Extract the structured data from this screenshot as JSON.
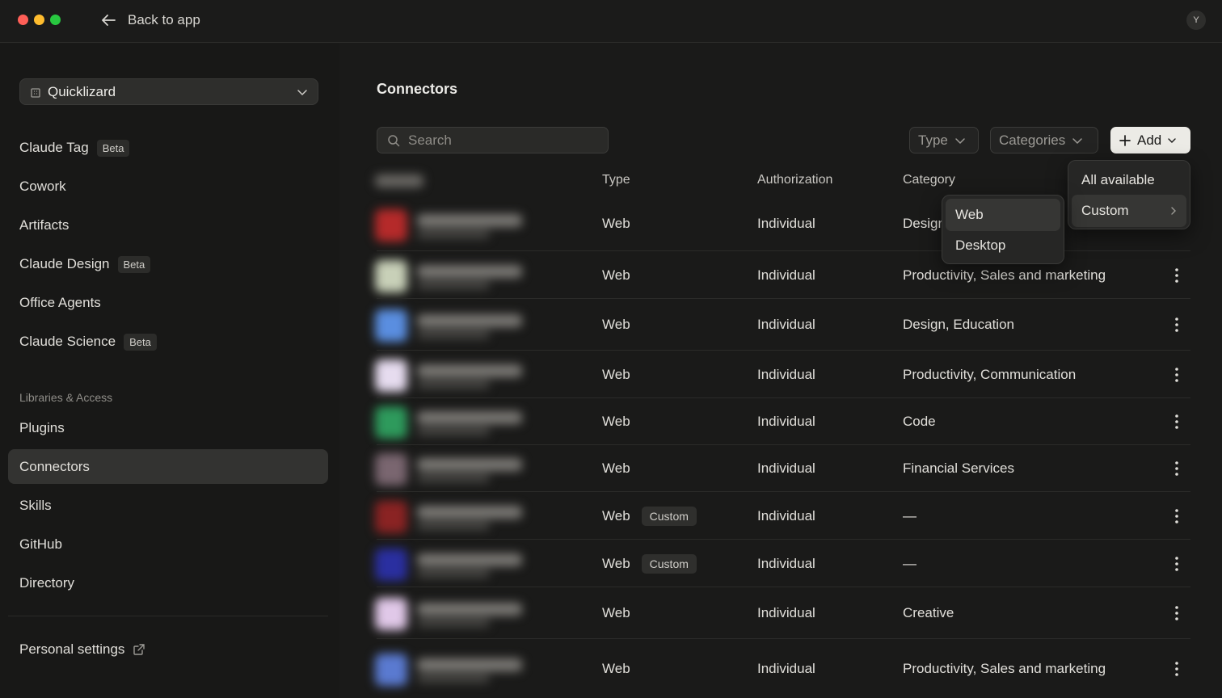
{
  "titlebar": {
    "back_label": "Back to app",
    "avatar_initial": "Y"
  },
  "sidebar": {
    "org_name": "Quicklizard",
    "items": [
      {
        "label": "Claude Tag",
        "badge": "Beta"
      },
      {
        "label": "Cowork",
        "badge": ""
      },
      {
        "label": "Artifacts",
        "badge": ""
      },
      {
        "label": "Claude Design",
        "badge": "Beta"
      },
      {
        "label": "Office Agents",
        "badge": ""
      },
      {
        "label": "Claude Science",
        "badge": "Beta"
      }
    ],
    "section_label": "Libraries & Access",
    "library_items": [
      {
        "label": "Plugins"
      },
      {
        "label": "Connectors",
        "active": true
      },
      {
        "label": "Skills"
      },
      {
        "label": "GitHub"
      },
      {
        "label": "Directory"
      }
    ],
    "personal_settings": "Personal settings"
  },
  "main": {
    "title": "Connectors",
    "search_placeholder": "Search",
    "filters": {
      "type": "Type",
      "categories": "Categories"
    },
    "add_label": "Add",
    "columns": {
      "type": "Type",
      "authorization": "Authorization",
      "category": "Category"
    },
    "rows": [
      {
        "type": "Web",
        "custom": "",
        "auth": "Individual",
        "category": "Design"
      },
      {
        "type": "Web",
        "custom": "",
        "auth": "Individual",
        "category": "Productivity, Sales and marketing"
      },
      {
        "type": "Web",
        "custom": "",
        "auth": "Individual",
        "category": "Design, Education"
      },
      {
        "type": "Web",
        "custom": "",
        "auth": "Individual",
        "category": "Productivity, Communication"
      },
      {
        "type": "Web",
        "custom": "",
        "auth": "Individual",
        "category": "Code"
      },
      {
        "type": "Web",
        "custom": "",
        "auth": "Individual",
        "category": "Financial Services"
      },
      {
        "type": "Web",
        "custom": "Custom",
        "auth": "Individual",
        "category": "—"
      },
      {
        "type": "Web",
        "custom": "Custom",
        "auth": "Individual",
        "category": "—"
      },
      {
        "type": "Web",
        "custom": "",
        "auth": "Individual",
        "category": "Creative"
      },
      {
        "type": "Web",
        "custom": "",
        "auth": "Individual",
        "category": "Productivity, Sales and marketing"
      }
    ],
    "blur_colors": [
      "#b52a2a",
      "#c8d0b8",
      "#5a8ee0",
      "#e6dcef",
      "#2e9a5c",
      "#7a6670",
      "#8a2323",
      "#2a2fa0",
      "#e0c8e8",
      "#5a7ad0"
    ]
  },
  "add_menu": {
    "items": [
      "All available",
      "Custom"
    ]
  },
  "type_submenu": {
    "items": [
      "Web",
      "Desktop"
    ]
  }
}
